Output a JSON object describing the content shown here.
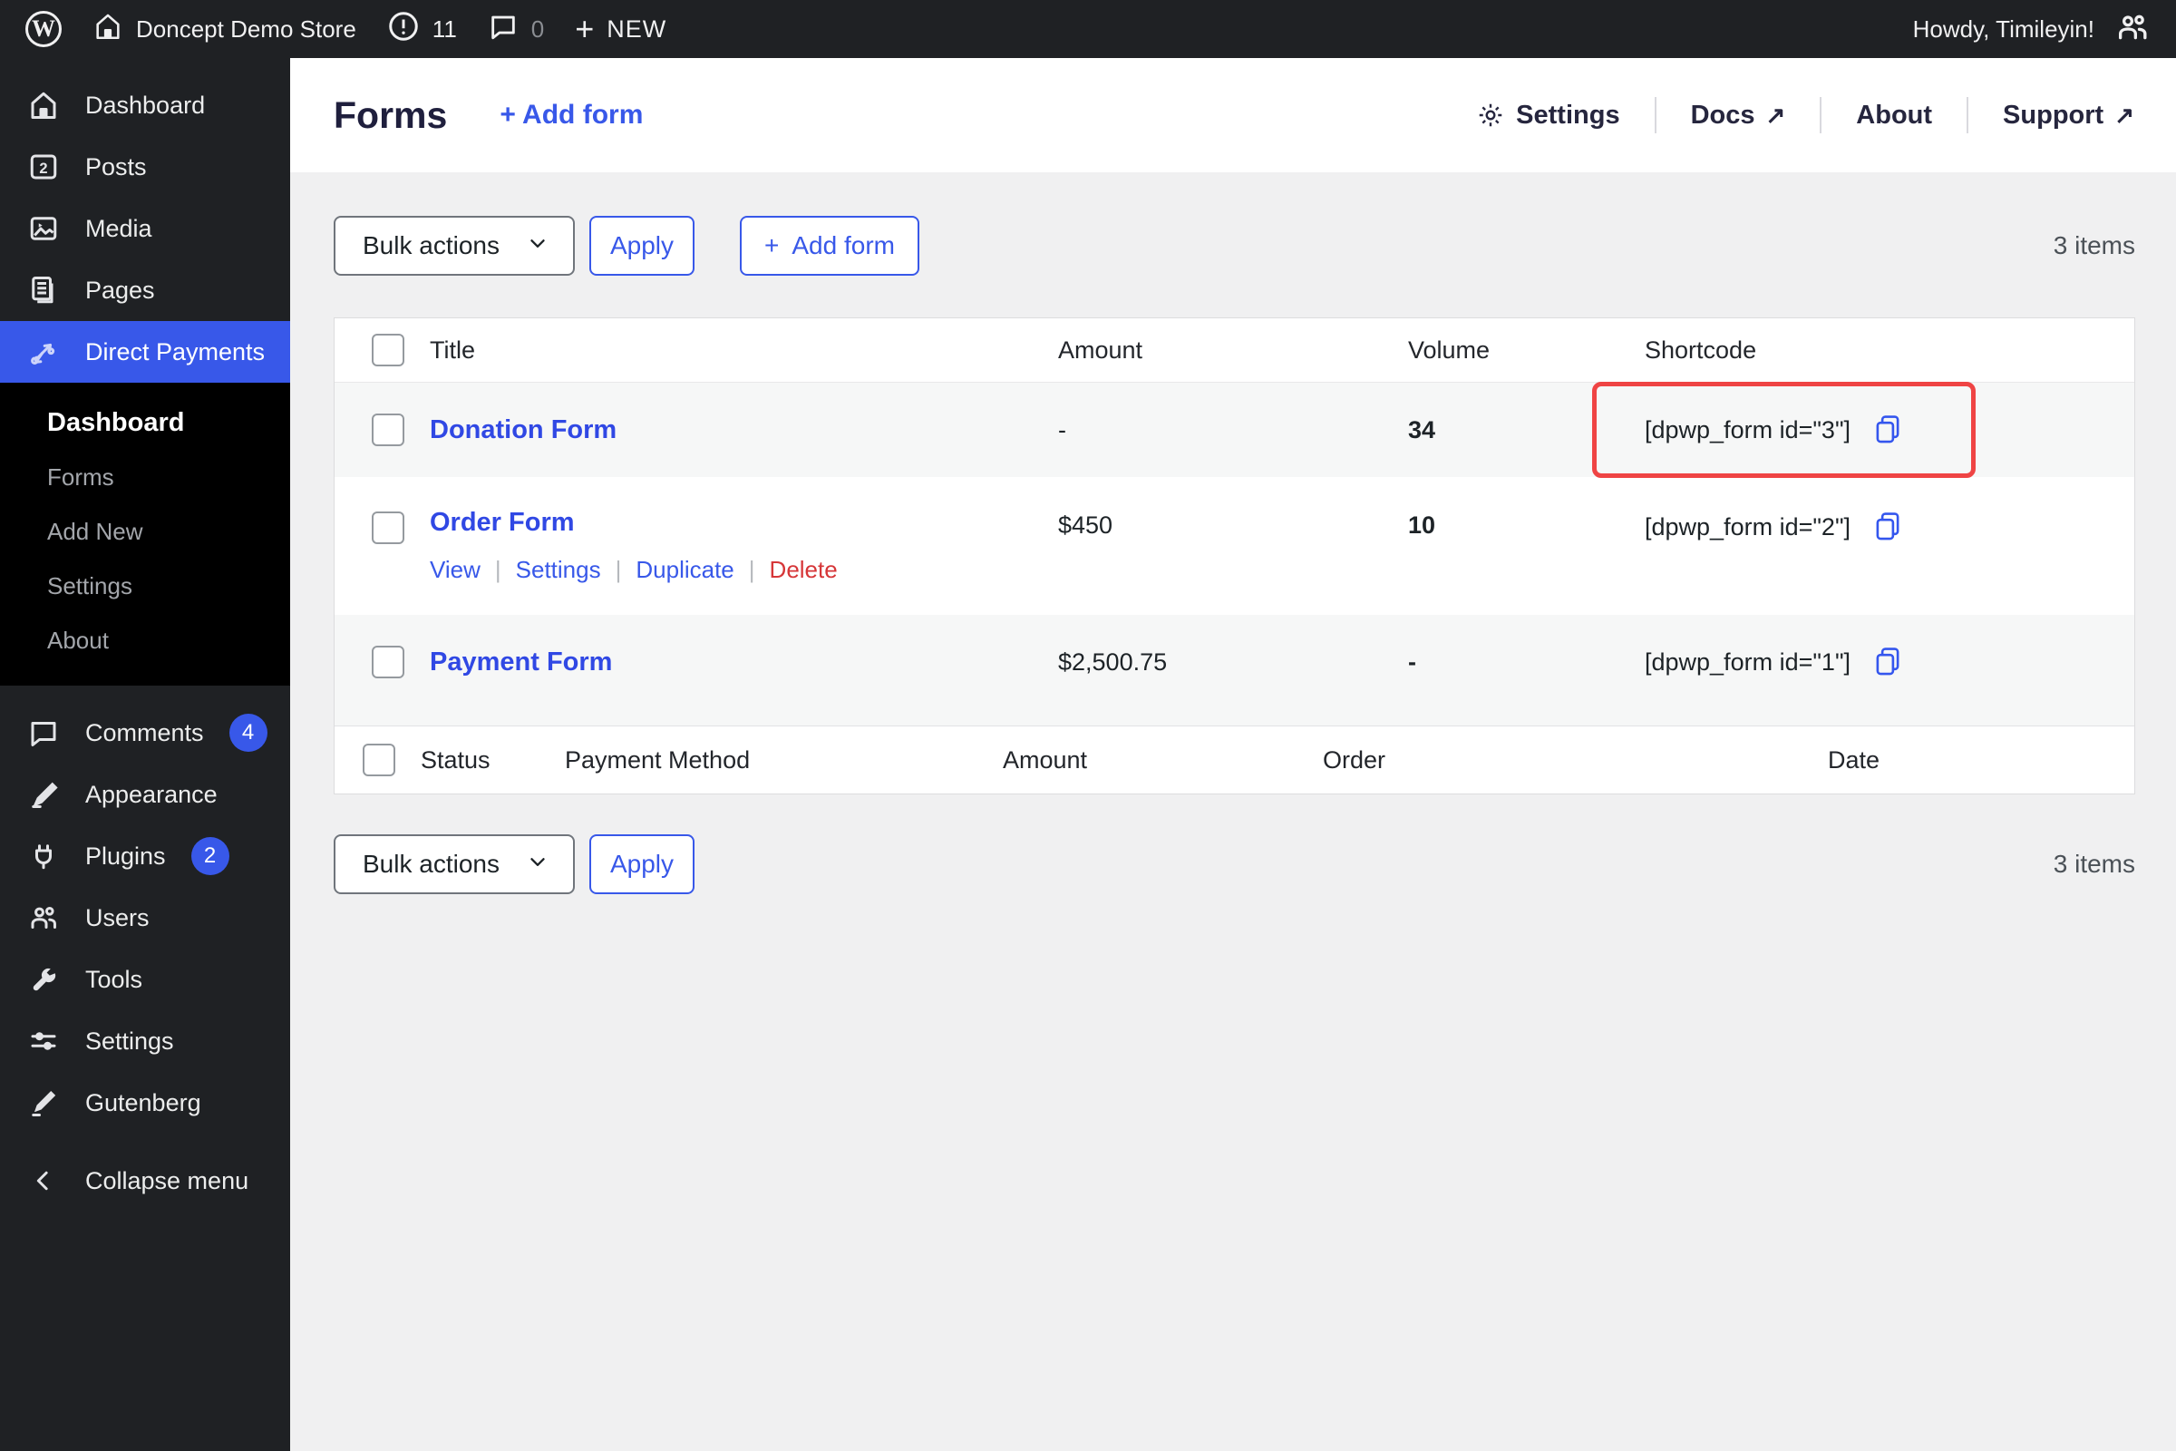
{
  "colors": {
    "accent": "#3858e9",
    "danger": "#d63638",
    "highlight_box": "#ef4444",
    "dark_chrome": "#1f2124",
    "submenu_bg": "#000000"
  },
  "admin_bar": {
    "site_name": "Doncept Demo Store",
    "update_count": "11",
    "comment_count": "0",
    "new_label": "NEW",
    "howdy": "Howdy, Timileyin!"
  },
  "sidebar": {
    "items": [
      {
        "label": "Dashboard"
      },
      {
        "label": "Posts",
        "icon_number": "2"
      },
      {
        "label": "Media"
      },
      {
        "label": "Pages"
      },
      {
        "label": "Direct Payments"
      },
      {
        "label": "Comments",
        "badge": "4"
      },
      {
        "label": "Appearance"
      },
      {
        "label": "Plugins",
        "badge": "2"
      },
      {
        "label": "Users"
      },
      {
        "label": "Tools"
      },
      {
        "label": "Settings"
      },
      {
        "label": "Gutenberg"
      },
      {
        "label": "Collapse menu"
      }
    ],
    "submenu": {
      "items": [
        {
          "label": "Dashboard",
          "current": true
        },
        {
          "label": "Forms"
        },
        {
          "label": "Add New"
        },
        {
          "label": "Settings"
        },
        {
          "label": "About"
        }
      ]
    }
  },
  "page_header": {
    "title": "Forms",
    "add_form_link": "+ Add form",
    "links": [
      {
        "label": "Settings"
      },
      {
        "label": "Docs",
        "external": "↗"
      },
      {
        "label": "About"
      },
      {
        "label": "Support",
        "external": "↗"
      }
    ]
  },
  "toolbar": {
    "bulk_actions_label": "Bulk actions",
    "apply_label": "Apply",
    "add_form_label": "Add form",
    "add_form_plus": "+",
    "items_count": "3 items"
  },
  "table": {
    "headers": [
      "Title",
      "Amount",
      "Volume",
      "Shortcode"
    ],
    "rows": [
      {
        "title": "Donation Form",
        "amount": "-",
        "volume": "34",
        "shortcode": "[dpwp_form id=\"3\"]",
        "highlighted": true
      },
      {
        "title": "Order Form",
        "amount": "$450",
        "volume": "10",
        "shortcode": "[dpwp_form id=\"2\"]",
        "actions": {
          "view": "View",
          "settings": "Settings",
          "duplicate": "Duplicate",
          "delete": "Delete"
        }
      },
      {
        "title": "Payment Form",
        "amount": "$2,500.75",
        "volume": "-",
        "shortcode": "[dpwp_form id=\"1\"]"
      }
    ],
    "footer_headers": [
      "Status",
      "Payment Method",
      "Amount",
      "Order",
      "Date"
    ]
  }
}
